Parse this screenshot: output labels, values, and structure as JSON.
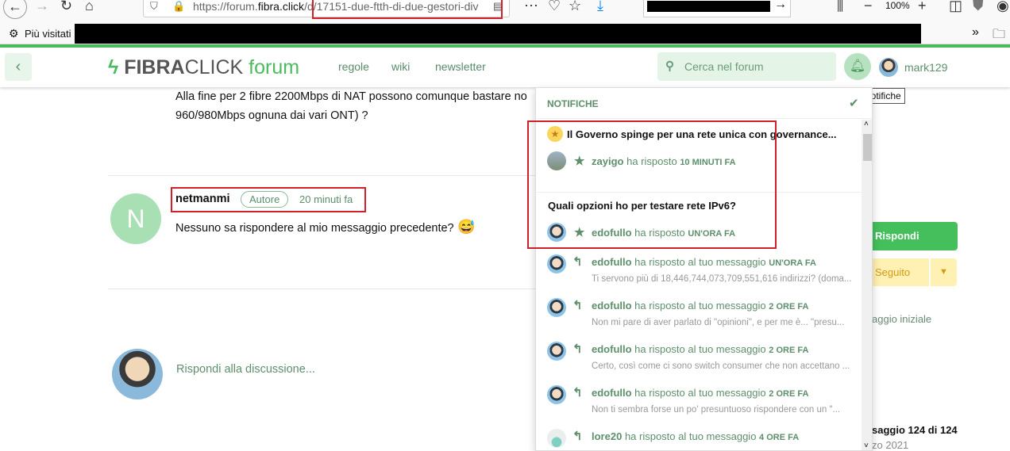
{
  "browser": {
    "url_host_prefix": "https://forum.",
    "url_host": "fibra.click",
    "url_path": "/d/17151-due-ftth-di-due-gestori-div",
    "zoom": "100%",
    "bookmark_label": "Più visitati"
  },
  "header": {
    "logo_bold": "FIBRA",
    "logo_light": "CLICK",
    "logo_forum": "forum",
    "nav": [
      "regole",
      "wiki",
      "newsletter"
    ],
    "search_placeholder": "Cerca nel forum",
    "username": "mark129",
    "tooltip": "Notifiche"
  },
  "posts": {
    "prev_text_1": "Alla fine per 2 fibre 2200Mbps di NAT possono comunque bastare no",
    "prev_text_2": "960/980Mbps ognuna dai vari ONT) ?",
    "author": "netmanmi",
    "avatar_letter": "N",
    "badge": "Autore",
    "time": "20 minuti fa",
    "body": "Nessuno sa rispondere al mio messaggio precedente?",
    "emoji": "😅",
    "reply_prompt": "Rispondi alla discussione..."
  },
  "sidebar": {
    "reply_button": "Rispondi",
    "follow_button": "Seguito",
    "start_link": "aggio iniziale",
    "scrub_position": "saggio 124 di 124",
    "scrub_date": "zo 2021"
  },
  "notifications": {
    "title": "NOTIFICHE",
    "groups": [
      {
        "discussion": "Il Governo spinge per una rete unica con governance...",
        "user": "zayigo",
        "action": "ha risposto",
        "time": "10 MINUTI FA"
      },
      {
        "discussion": "Quali opzioni ho per testare rete IPv6?",
        "user": "edofullo",
        "action": "ha risposto",
        "time": "UN'ORA FA"
      }
    ],
    "items": [
      {
        "user": "edofullo",
        "action": "ha risposto al tuo messaggio",
        "time": "UN'ORA FA",
        "excerpt": "Ti servono più di 18,446,744,073,709,551,616 indirizzi? (doma..."
      },
      {
        "user": "edofullo",
        "action": "ha risposto al tuo messaggio",
        "time": "2 ORE FA",
        "excerpt": "Non mi pare di aver parlato di \"opinioni\", e per me è... \"presu..."
      },
      {
        "user": "edofullo",
        "action": "ha risposto al tuo messaggio",
        "time": "2 ORE FA",
        "excerpt": "Certo, così come ci sono switch consumer che non accettano ..."
      },
      {
        "user": "edofullo",
        "action": "ha risposto al tuo messaggio",
        "time": "2 ORE FA",
        "excerpt": "Non ti sembra forse un po' presuntuoso rispondere con un \"..."
      },
      {
        "user": "lore20",
        "action": "ha risposto al tuo messaggio",
        "time": "4 ORE FA",
        "excerpt": ""
      }
    ]
  },
  "colors": {
    "accent": "#4cbb5f",
    "text_green": "#5d8f6b",
    "follow_bg": "#fff0b3"
  }
}
